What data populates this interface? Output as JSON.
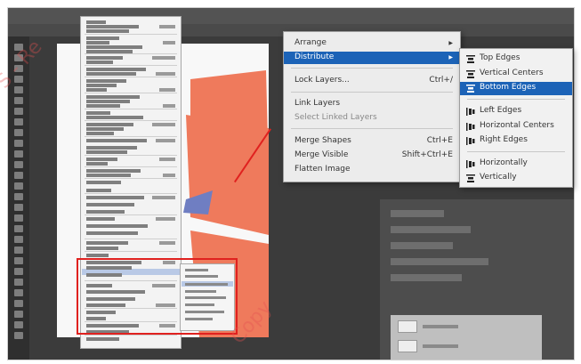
{
  "zoom_menu": {
    "items": [
      {
        "label": "Arrange",
        "shortcut": "",
        "arrow": true,
        "highlight": false,
        "dim": false
      },
      {
        "label": "Distribute",
        "shortcut": "",
        "arrow": true,
        "highlight": true,
        "dim": false
      },
      {
        "label": "Lock Layers...",
        "shortcut": "Ctrl+/",
        "arrow": false,
        "highlight": false,
        "dim": false
      },
      {
        "label": "Link Layers",
        "shortcut": "",
        "arrow": false,
        "highlight": false,
        "dim": false
      },
      {
        "label": "Select Linked Layers",
        "shortcut": "",
        "arrow": false,
        "highlight": false,
        "dim": true
      },
      {
        "label": "Merge Shapes",
        "shortcut": "Ctrl+E",
        "arrow": false,
        "highlight": false,
        "dim": false
      },
      {
        "label": "Merge Visible",
        "shortcut": "Shift+Ctrl+E",
        "arrow": false,
        "highlight": false,
        "dim": false
      },
      {
        "label": "Flatten Image",
        "shortcut": "",
        "arrow": false,
        "highlight": false,
        "dim": false
      }
    ]
  },
  "distribute_submenu": {
    "items": [
      {
        "label": "Top Edges",
        "icon": "distribute-top-icon",
        "highlight": false
      },
      {
        "label": "Vertical Centers",
        "icon": "distribute-vcenter-icon",
        "highlight": false
      },
      {
        "label": "Bottom Edges",
        "icon": "distribute-bottom-icon",
        "highlight": true
      },
      {
        "label": "Left Edges",
        "icon": "distribute-left-icon",
        "highlight": false
      },
      {
        "label": "Horizontal Centers",
        "icon": "distribute-hcenter-icon",
        "highlight": false
      },
      {
        "label": "Right Edges",
        "icon": "distribute-right-icon",
        "highlight": false
      },
      {
        "label": "Horizontally",
        "icon": "distribute-horizontal-icon",
        "highlight": false
      },
      {
        "label": "Vertically",
        "icon": "distribute-vertical-icon",
        "highlight": false
      }
    ]
  },
  "colors": {
    "highlight": "#1c63b7",
    "callout": "#e0211f",
    "shape_orange": "#ef7a5c",
    "shape_blue": "#6f7ec2"
  }
}
